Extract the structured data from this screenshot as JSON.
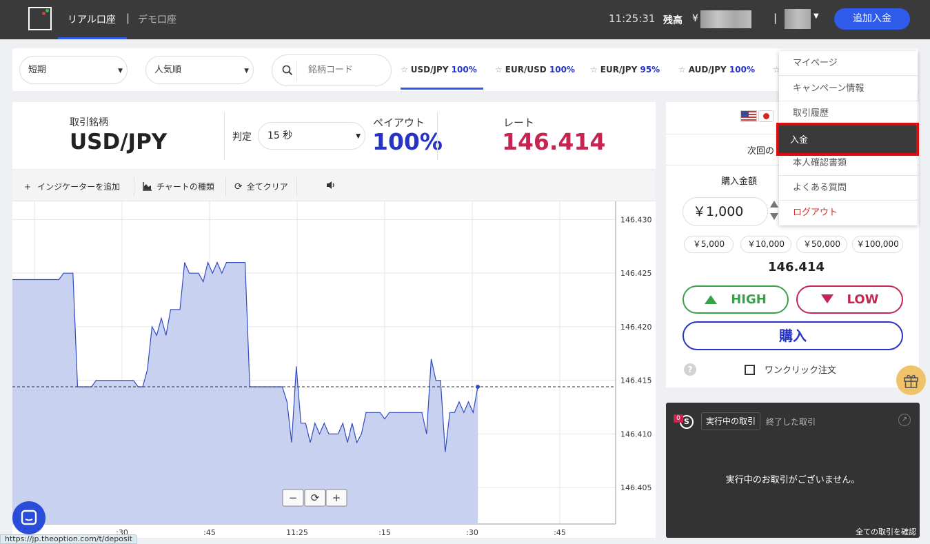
{
  "header": {
    "tab_real": "リアル口座",
    "tab_separator": "|",
    "tab_demo": "デモ口座",
    "clock": "11:25:31",
    "balance_label": "残高",
    "balance_currency": "¥",
    "separator": "|",
    "deposit_button": "追加入金"
  },
  "filters": {
    "term": "短期",
    "sort": "人気順",
    "search_placeholder": "銘柄コード",
    "pairs": [
      {
        "name": "USD/JPY",
        "payout": "100%"
      },
      {
        "name": "EUR/USD",
        "payout": "100%"
      },
      {
        "name": "EUR/JPY",
        "payout": "95%"
      },
      {
        "name": "AUD/JPY",
        "payout": "100%"
      }
    ]
  },
  "trade": {
    "symbol_label": "取引銘柄",
    "symbol": "USD/JPY",
    "expiry_label": "判定",
    "expiry": "15 秒",
    "payout_label": "ペイアウト",
    "payout": "100%",
    "rate_label": "レート",
    "rate": "146.414"
  },
  "toolbar": {
    "add_indicator": "インジケーターを追加",
    "chart_type": "チャートの種類",
    "clear_all": "全てクリア"
  },
  "chart_data": {
    "type": "area",
    "y_ticks": [
      "146.430",
      "146.425",
      "146.420",
      "146.415",
      "146.410",
      "146.405"
    ],
    "x_ticks": [
      ":30",
      ":45",
      "11:25",
      ":15",
      ":30",
      ":45"
    ],
    "ylim": [
      146.4016,
      146.4317
    ],
    "current_price": 146.4144,
    "price_line": 146.4144,
    "series": [
      {
        "values": [
          146.4244,
          146.4244,
          146.4244,
          146.4244,
          146.4244,
          146.4244,
          146.4244,
          146.4244,
          146.4244,
          146.4244,
          146.4244,
          146.425,
          146.425,
          146.425,
          146.4144,
          146.4144,
          146.4144,
          146.4144,
          146.415,
          146.415,
          146.415,
          146.415,
          146.415,
          146.415,
          146.415,
          146.415,
          146.415,
          146.4144,
          146.4144,
          146.416,
          146.42,
          146.4192,
          146.4208,
          146.4192,
          146.4216,
          146.4216,
          146.4216,
          146.426,
          146.425,
          146.425,
          146.425,
          146.4242,
          146.426,
          146.425,
          146.426,
          146.425,
          146.426,
          146.426,
          146.426,
          146.426,
          146.426,
          146.4144,
          146.4144,
          146.4144,
          146.4144,
          146.4144,
          146.4144,
          146.4144,
          146.4144,
          146.413,
          146.4092,
          146.4163,
          146.411,
          146.411,
          146.4092,
          146.411,
          146.41,
          146.411,
          146.41,
          146.41,
          146.41,
          146.411,
          146.4092,
          146.411,
          146.4092,
          146.41,
          146.412,
          146.412,
          146.412,
          146.412,
          146.4114,
          146.412,
          146.412,
          146.412,
          146.412,
          146.412,
          146.412,
          146.412,
          146.412,
          146.41,
          146.417,
          146.415,
          146.415,
          146.4083,
          146.412,
          146.412,
          146.413,
          146.412,
          146.413,
          146.412,
          146.4144
        ]
      }
    ],
    "grid": true
  },
  "right_panel": {
    "next_label": "次回の",
    "amount_label": "購入金額",
    "amount": "￥1,000",
    "presets": [
      "￥5,000",
      "￥10,000",
      "￥50,000",
      "￥100,000"
    ],
    "rate": "146.414",
    "high": "HIGH",
    "low": "LOW",
    "buy": "購入",
    "help": "?",
    "one_click": "ワンクリック注文"
  },
  "trades": {
    "badge": "0",
    "icon": "S",
    "tab_active": "実行中の取引",
    "tab_done": "終了した取引",
    "empty": "実行中のお取引がございません。",
    "view_all": "全ての取引を確認"
  },
  "dropdown": {
    "items": [
      "マイページ",
      "キャンペーン情報",
      "取引履歴",
      "入金",
      "本人確認書類",
      "よくある質問",
      "ログアウト"
    ]
  },
  "status_url": "https://jp.theoption.com/t/deposit",
  "colors": {
    "accent": "#2f5bea",
    "payout": "#2633c4",
    "rate": "#c4264f",
    "high": "#3aa04a",
    "highlight": "#e20a0a"
  }
}
